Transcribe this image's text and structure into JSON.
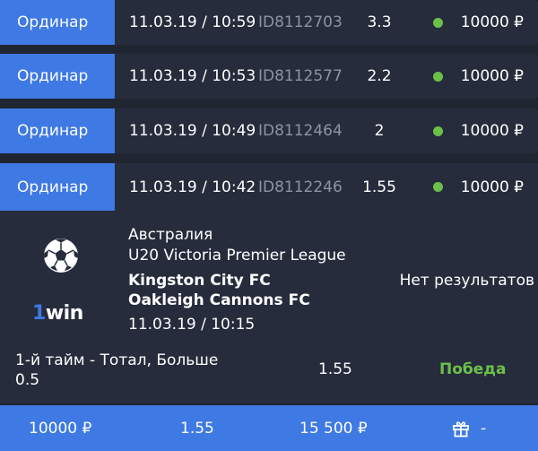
{
  "bets": [
    {
      "type": "Ординар",
      "datetime": "11.03.19 / 10:59",
      "id": "ID8112703",
      "odds": "3.3",
      "amount": "10000 ₽"
    },
    {
      "type": "Ординар",
      "datetime": "11.03.19 / 10:53",
      "id": "ID8112577",
      "odds": "2.2",
      "amount": "10000 ₽"
    },
    {
      "type": "Ординар",
      "datetime": "11.03.19 / 10:49",
      "id": "ID8112464",
      "odds": "2",
      "amount": "10000 ₽"
    },
    {
      "type": "Ординар",
      "datetime": "11.03.19 / 10:42",
      "id": "ID8112246",
      "odds": "1.55",
      "amount": "10000 ₽"
    }
  ],
  "status_color": "#6cc04a",
  "detail": {
    "brand": {
      "prefix": "1",
      "name": "win"
    },
    "country": "Австралия",
    "league": "U20 Victoria Premier League",
    "team1": "Kingston City FC",
    "team2": "Oakleigh Cannons FC",
    "match_datetime": "11.03.19 / 10:15",
    "result": "Нет результатов",
    "market_line1": "1-й тайм - Тотал, Больше",
    "market_line2": "0.5",
    "odds": "1.55",
    "outcome": "Победа"
  },
  "footer": {
    "stake": "10000 ₽",
    "odds": "1.55",
    "payout": "15 500 ₽",
    "bonus": "-"
  }
}
